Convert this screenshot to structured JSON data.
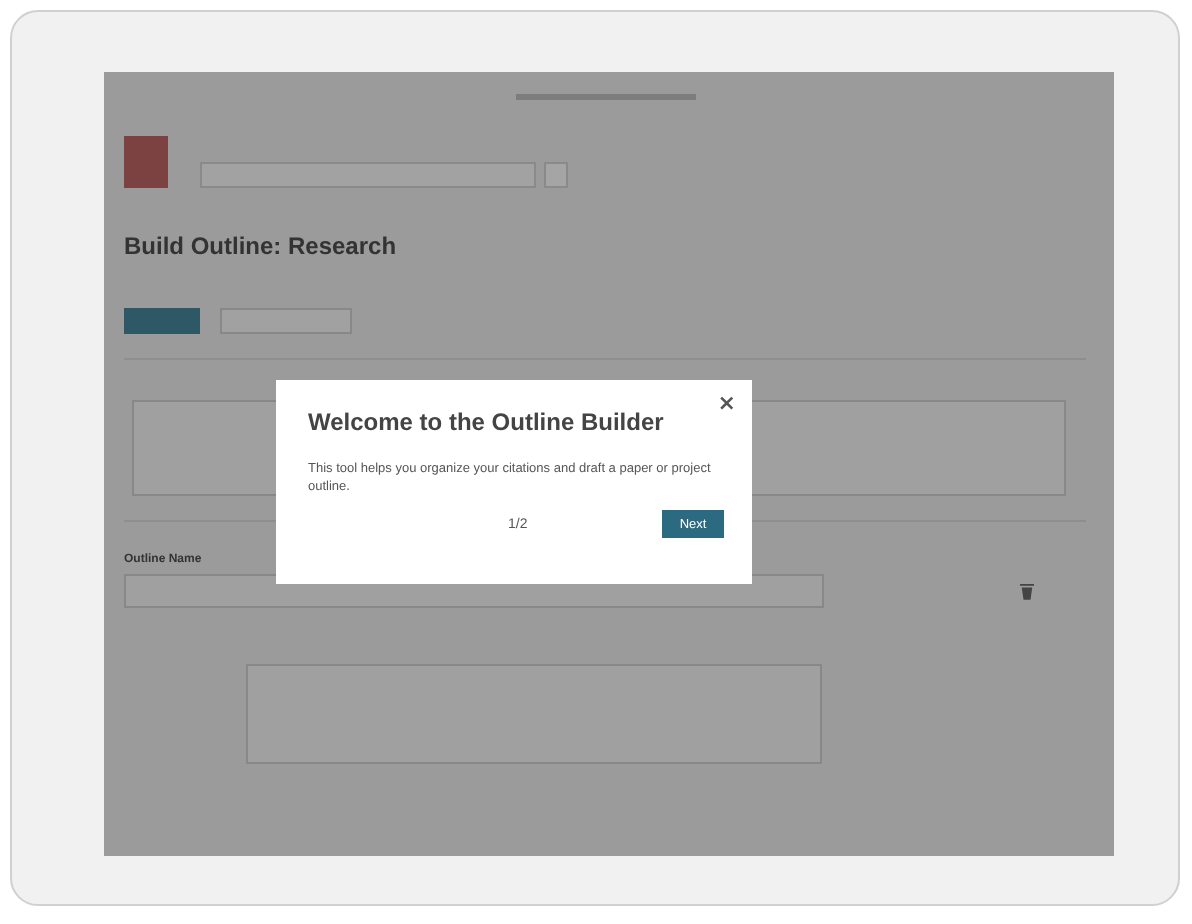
{
  "page": {
    "title": "Build Outline: Research",
    "outline_label": "Outline Name"
  },
  "dialog": {
    "title": "Welcome to the Outline Builder",
    "close": "×",
    "text": "This tool helps you organize your citations and draft a paper or project outline.",
    "step": "1/2",
    "next_button": "Next"
  }
}
